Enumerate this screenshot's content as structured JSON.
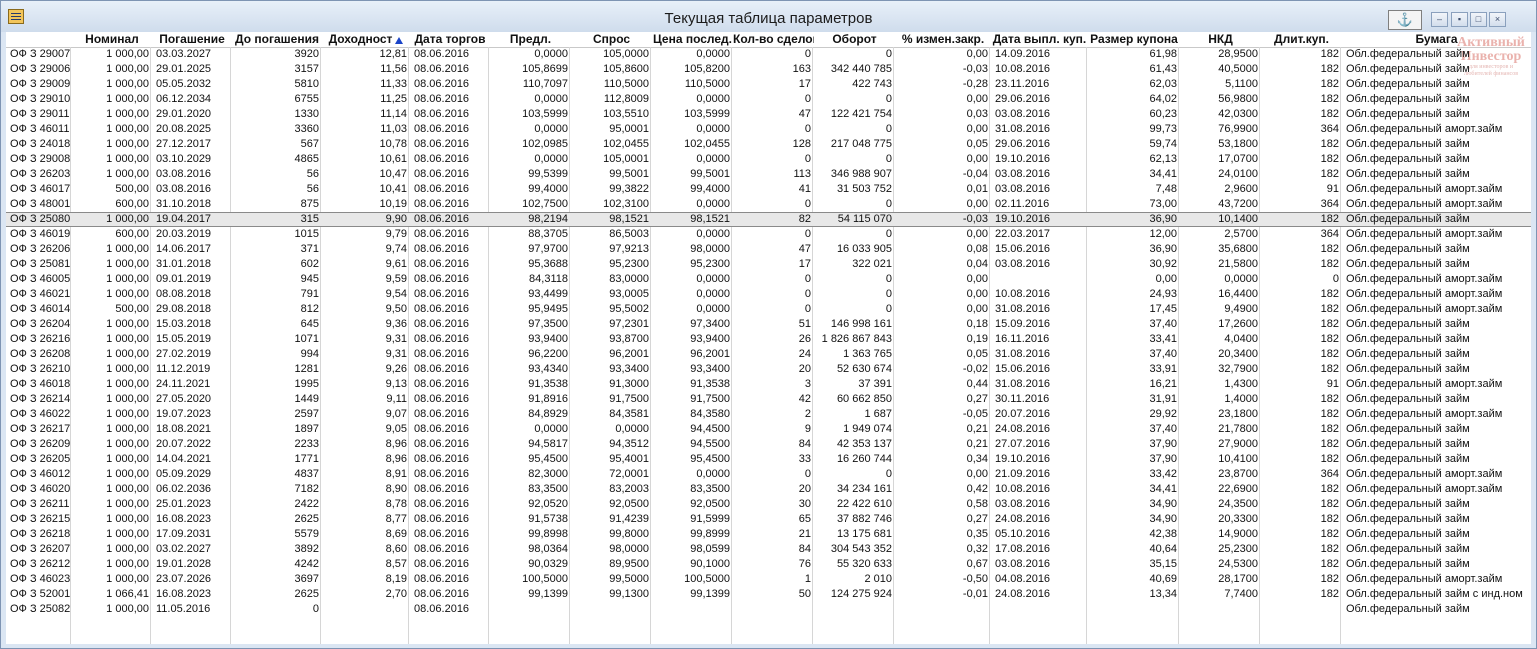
{
  "window": {
    "title": "Текущая таблица параметров",
    "anchor_icon": "anchor-icon",
    "menu_icon": "window-menu-icon"
  },
  "columns": [
    "",
    "Номинал",
    "Погашение",
    "До погашения",
    "Доходност",
    "Дата торгов",
    "Предл.",
    "Спрос",
    "Цена послед.",
    "Кол-во сделок",
    "Оборот",
    "% измен.закр.",
    "Дата выпл. куп.",
    "Размер купона",
    "НКД",
    "Длит.куп.",
    "Бумага"
  ],
  "sort": {
    "column": "Доходност",
    "direction": "desc",
    "icon": "sort-arrow-up-icon"
  },
  "selected_row": 11,
  "rows": [
    [
      "ОФ З 29007",
      "1 000,00",
      "03.03.2027",
      "3920",
      "12,81",
      "08.06.2016",
      "0,0000",
      "105,0000",
      "0,0000",
      "0",
      "0",
      "0,00",
      "14.09.2016",
      "61,98",
      "28,9500",
      "182",
      "Обл.федеральный займ"
    ],
    [
      "ОФ З 29006",
      "1 000,00",
      "29.01.2025",
      "3157",
      "11,56",
      "08.06.2016",
      "105,8699",
      "105,8600",
      "105,8200",
      "163",
      "342 440 785",
      "-0,03",
      "10.08.2016",
      "61,43",
      "40,5000",
      "182",
      "Обл.федеральный займ"
    ],
    [
      "ОФ З 29009",
      "1 000,00",
      "05.05.2032",
      "5810",
      "11,33",
      "08.06.2016",
      "110,7097",
      "110,5000",
      "110,5000",
      "17",
      "422 743",
      "-0,28",
      "23.11.2016",
      "62,03",
      "5,1100",
      "182",
      "Обл.федеральный займ"
    ],
    [
      "ОФ З 29010",
      "1 000,00",
      "06.12.2034",
      "6755",
      "11,25",
      "08.06.2016",
      "0,0000",
      "112,8009",
      "0,0000",
      "0",
      "0",
      "0,00",
      "29.06.2016",
      "64,02",
      "56,9800",
      "182",
      "Обл.федеральный займ"
    ],
    [
      "ОФ З 29011",
      "1 000,00",
      "29.01.2020",
      "1330",
      "11,14",
      "08.06.2016",
      "103,5999",
      "103,5510",
      "103,5999",
      "47",
      "122 421 754",
      "0,03",
      "03.08.2016",
      "60,23",
      "42,0300",
      "182",
      "Обл.федеральный займ"
    ],
    [
      "ОФ З 46011",
      "1 000,00",
      "20.08.2025",
      "3360",
      "11,03",
      "08.06.2016",
      "0,0000",
      "95,0001",
      "0,0000",
      "0",
      "0",
      "0,00",
      "31.08.2016",
      "99,73",
      "76,9900",
      "364",
      "Обл.федеральный аморт.займ"
    ],
    [
      "ОФ З 24018",
      "1 000,00",
      "27.12.2017",
      "567",
      "10,78",
      "08.06.2016",
      "102,0985",
      "102,0455",
      "102,0455",
      "128",
      "217 048 775",
      "0,05",
      "29.06.2016",
      "59,74",
      "53,1800",
      "182",
      "Обл.федеральный займ"
    ],
    [
      "ОФ З 29008",
      "1 000,00",
      "03.10.2029",
      "4865",
      "10,61",
      "08.06.2016",
      "0,0000",
      "105,0001",
      "0,0000",
      "0",
      "0",
      "0,00",
      "19.10.2016",
      "62,13",
      "17,0700",
      "182",
      "Обл.федеральный займ"
    ],
    [
      "ОФ З 26203",
      "1 000,00",
      "03.08.2016",
      "56",
      "10,47",
      "08.06.2016",
      "99,5399",
      "99,5001",
      "99,5001",
      "113",
      "346 988 907",
      "-0,04",
      "03.08.2016",
      "34,41",
      "24,0100",
      "182",
      "Обл.федеральный займ"
    ],
    [
      "ОФ З 46017",
      "500,00",
      "03.08.2016",
      "56",
      "10,41",
      "08.06.2016",
      "99,4000",
      "99,3822",
      "99,4000",
      "41",
      "31 503 752",
      "0,01",
      "03.08.2016",
      "7,48",
      "2,9600",
      "91",
      "Обл.федеральный аморт.займ"
    ],
    [
      "ОФ З 48001",
      "600,00",
      "31.10.2018",
      "875",
      "10,19",
      "08.06.2016",
      "102,7500",
      "102,3100",
      "0,0000",
      "0",
      "0",
      "0,00",
      "02.11.2016",
      "73,00",
      "43,7200",
      "364",
      "Обл.федеральный аморт.займ"
    ],
    [
      "ОФ З 25080",
      "1 000,00",
      "19.04.2017",
      "315",
      "9,90",
      "08.06.2016",
      "98,2194",
      "98,1521",
      "98,1521",
      "82",
      "54 115 070",
      "-0,03",
      "19.10.2016",
      "36,90",
      "10,1400",
      "182",
      "Обл.федеральный займ"
    ],
    [
      "ОФ З 46019",
      "600,00",
      "20.03.2019",
      "1015",
      "9,79",
      "08.06.2016",
      "88,3705",
      "86,5003",
      "0,0000",
      "0",
      "0",
      "0,00",
      "22.03.2017",
      "12,00",
      "2,5700",
      "364",
      "Обл.федеральный аморт.займ"
    ],
    [
      "ОФ З 26206",
      "1 000,00",
      "14.06.2017",
      "371",
      "9,74",
      "08.06.2016",
      "97,9700",
      "97,9213",
      "98,0000",
      "47",
      "16 033 905",
      "0,08",
      "15.06.2016",
      "36,90",
      "35,6800",
      "182",
      "Обл.федеральный займ"
    ],
    [
      "ОФ З 25081",
      "1 000,00",
      "31.01.2018",
      "602",
      "9,61",
      "08.06.2016",
      "95,3688",
      "95,2300",
      "95,2300",
      "17",
      "322 021",
      "0,04",
      "03.08.2016",
      "30,92",
      "21,5800",
      "182",
      "Обл.федеральный займ"
    ],
    [
      "ОФ З 46005",
      "1 000,00",
      "09.01.2019",
      "945",
      "9,59",
      "08.06.2016",
      "84,3118",
      "83,0000",
      "0,0000",
      "0",
      "0",
      "0,00",
      "",
      "0,00",
      "0,0000",
      "0",
      "Обл.федеральный аморт.займ"
    ],
    [
      "ОФ З 46021",
      "1 000,00",
      "08.08.2018",
      "791",
      "9,54",
      "08.06.2016",
      "93,4499",
      "93,0005",
      "0,0000",
      "0",
      "0",
      "0,00",
      "10.08.2016",
      "24,93",
      "16,4400",
      "182",
      "Обл.федеральный аморт.займ"
    ],
    [
      "ОФ З 46014",
      "500,00",
      "29.08.2018",
      "812",
      "9,50",
      "08.06.2016",
      "95,9495",
      "95,5002",
      "0,0000",
      "0",
      "0",
      "0,00",
      "31.08.2016",
      "17,45",
      "9,4900",
      "182",
      "Обл.федеральный аморт.займ"
    ],
    [
      "ОФ З 26204",
      "1 000,00",
      "15.03.2018",
      "645",
      "9,36",
      "08.06.2016",
      "97,3500",
      "97,2301",
      "97,3400",
      "51",
      "146 998 161",
      "0,18",
      "15.09.2016",
      "37,40",
      "17,2600",
      "182",
      "Обл.федеральный займ"
    ],
    [
      "ОФ З 26216",
      "1 000,00",
      "15.05.2019",
      "1071",
      "9,31",
      "08.06.2016",
      "93,9400",
      "93,8700",
      "93,9400",
      "26",
      "1 826 867 843",
      "0,19",
      "16.11.2016",
      "33,41",
      "4,0400",
      "182",
      "Обл.федеральный займ"
    ],
    [
      "ОФ З 26208",
      "1 000,00",
      "27.02.2019",
      "994",
      "9,31",
      "08.06.2016",
      "96,2200",
      "96,2001",
      "96,2001",
      "24",
      "1 363 765",
      "0,05",
      "31.08.2016",
      "37,40",
      "20,3400",
      "182",
      "Обл.федеральный займ"
    ],
    [
      "ОФ З 26210",
      "1 000,00",
      "11.12.2019",
      "1281",
      "9,26",
      "08.06.2016",
      "93,4340",
      "93,3400",
      "93,3400",
      "20",
      "52 630 674",
      "-0,02",
      "15.06.2016",
      "33,91",
      "32,7900",
      "182",
      "Обл.федеральный займ"
    ],
    [
      "ОФ З 46018",
      "1 000,00",
      "24.11.2021",
      "1995",
      "9,13",
      "08.06.2016",
      "91,3538",
      "91,3000",
      "91,3538",
      "3",
      "37 391",
      "0,44",
      "31.08.2016",
      "16,21",
      "1,4300",
      "91",
      "Обл.федеральный аморт.займ"
    ],
    [
      "ОФ З 26214",
      "1 000,00",
      "27.05.2020",
      "1449",
      "9,11",
      "08.06.2016",
      "91,8916",
      "91,7500",
      "91,7500",
      "42",
      "60 662 850",
      "0,27",
      "30.11.2016",
      "31,91",
      "1,4000",
      "182",
      "Обл.федеральный займ"
    ],
    [
      "ОФ З 46022",
      "1 000,00",
      "19.07.2023",
      "2597",
      "9,07",
      "08.06.2016",
      "84,8929",
      "84,3581",
      "84,3580",
      "2",
      "1 687",
      "-0,05",
      "20.07.2016",
      "29,92",
      "23,1800",
      "182",
      "Обл.федеральный аморт.займ"
    ],
    [
      "ОФ З 26217",
      "1 000,00",
      "18.08.2021",
      "1897",
      "9,05",
      "08.06.2016",
      "0,0000",
      "0,0000",
      "94,4500",
      "9",
      "1 949 074",
      "0,21",
      "24.08.2016",
      "37,40",
      "21,7800",
      "182",
      "Обл.федеральный займ"
    ],
    [
      "ОФ З 26209",
      "1 000,00",
      "20.07.2022",
      "2233",
      "8,96",
      "08.06.2016",
      "94,5817",
      "94,3512",
      "94,5500",
      "84",
      "42 353 137",
      "0,21",
      "27.07.2016",
      "37,90",
      "27,9000",
      "182",
      "Обл.федеральный займ"
    ],
    [
      "ОФ З 26205",
      "1 000,00",
      "14.04.2021",
      "1771",
      "8,96",
      "08.06.2016",
      "95,4500",
      "95,4001",
      "95,4500",
      "33",
      "16 260 744",
      "0,34",
      "19.10.2016",
      "37,90",
      "10,4100",
      "182",
      "Обл.федеральный займ"
    ],
    [
      "ОФ З 46012",
      "1 000,00",
      "05.09.2029",
      "4837",
      "8,91",
      "08.06.2016",
      "82,3000",
      "72,0001",
      "0,0000",
      "0",
      "0",
      "0,00",
      "21.09.2016",
      "33,42",
      "23,8700",
      "364",
      "Обл.федеральный аморт.займ"
    ],
    [
      "ОФ З 46020",
      "1 000,00",
      "06.02.2036",
      "7182",
      "8,90",
      "08.06.2016",
      "83,3500",
      "83,2003",
      "83,3500",
      "20",
      "34 234 161",
      "0,42",
      "10.08.2016",
      "34,41",
      "22,6900",
      "182",
      "Обл.федеральный аморт.займ"
    ],
    [
      "ОФ З 26211",
      "1 000,00",
      "25.01.2023",
      "2422",
      "8,78",
      "08.06.2016",
      "92,0520",
      "92,0500",
      "92,0500",
      "30",
      "22 422 610",
      "0,58",
      "03.08.2016",
      "34,90",
      "24,3500",
      "182",
      "Обл.федеральный займ"
    ],
    [
      "ОФ З 26215",
      "1 000,00",
      "16.08.2023",
      "2625",
      "8,77",
      "08.06.2016",
      "91,5738",
      "91,4239",
      "91,5999",
      "65",
      "37 882 746",
      "0,27",
      "24.08.2016",
      "34,90",
      "20,3300",
      "182",
      "Обл.федеральный займ"
    ],
    [
      "ОФ З 26218",
      "1 000,00",
      "17.09.2031",
      "5579",
      "8,69",
      "08.06.2016",
      "99,8998",
      "99,8000",
      "99,8999",
      "21",
      "13 175 681",
      "0,35",
      "05.10.2016",
      "42,38",
      "14,9000",
      "182",
      "Обл.федеральный займ"
    ],
    [
      "ОФ З 26207",
      "1 000,00",
      "03.02.2027",
      "3892",
      "8,60",
      "08.06.2016",
      "98,0364",
      "98,0000",
      "98,0599",
      "84",
      "304 543 352",
      "0,32",
      "17.08.2016",
      "40,64",
      "25,2300",
      "182",
      "Обл.федеральный займ"
    ],
    [
      "ОФ З 26212",
      "1 000,00",
      "19.01.2028",
      "4242",
      "8,57",
      "08.06.2016",
      "90,0329",
      "89,9500",
      "90,1000",
      "76",
      "55 320 633",
      "0,67",
      "03.08.2016",
      "35,15",
      "24,5300",
      "182",
      "Обл.федеральный займ"
    ],
    [
      "ОФ З 46023",
      "1 000,00",
      "23.07.2026",
      "3697",
      "8,19",
      "08.06.2016",
      "100,5000",
      "99,5000",
      "100,5000",
      "1",
      "2 010",
      "-0,50",
      "04.08.2016",
      "40,69",
      "28,1700",
      "182",
      "Обл.федеральный аморт.займ"
    ],
    [
      "ОФ З 52001",
      "1 066,41",
      "16.08.2023",
      "2625",
      "2,70",
      "08.06.2016",
      "99,1399",
      "99,1300",
      "99,1399",
      "50",
      "124 275 924",
      "-0,01",
      "24.08.2016",
      "13,34",
      "7,7400",
      "182",
      "Обл.федеральный займ с инд.ном"
    ],
    [
      "ОФ З 25082",
      "1 000,00",
      "11.05.2016",
      "0",
      "",
      "08.06.2016",
      "",
      "",
      "",
      "",
      "",
      "",
      "",
      "",
      "",
      "",
      "Обл.федеральный займ"
    ]
  ],
  "watermark": {
    "line1": "Активный",
    "line2": "Инвестор",
    "line3": "для инвесторов и",
    "line4": "любителей финансов"
  }
}
